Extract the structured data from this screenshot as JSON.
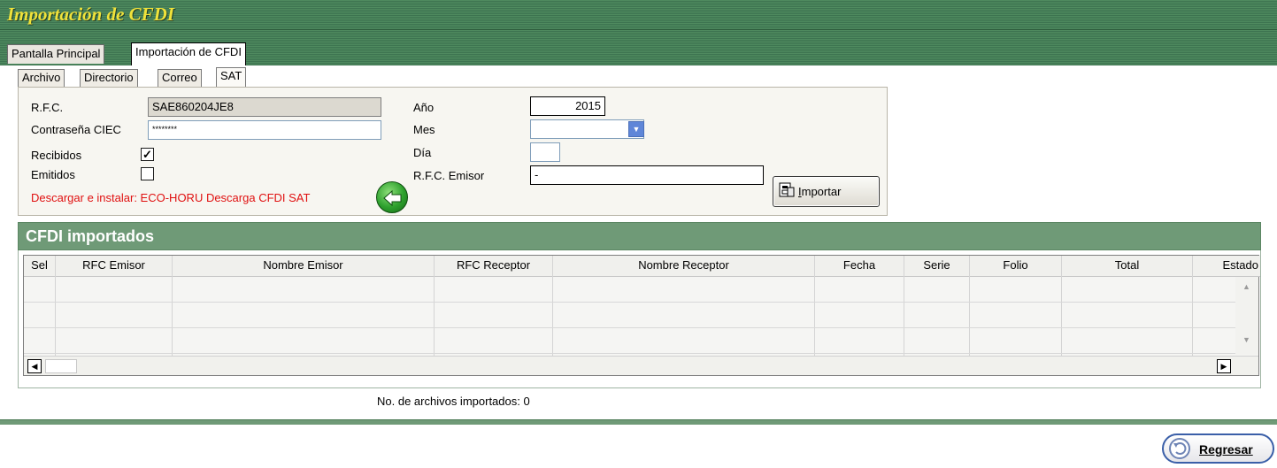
{
  "window": {
    "title": "Importación de CFDI"
  },
  "main_tabs": [
    {
      "label": "Pantalla Principal",
      "active": false
    },
    {
      "label": "Importación de CFDI",
      "active": true
    }
  ],
  "sub_tabs": [
    {
      "label": "Archivo",
      "active": false
    },
    {
      "label": "Directorio",
      "active": false
    },
    {
      "label": "Correo",
      "active": false
    },
    {
      "label": "SAT",
      "active": true
    }
  ],
  "sat_form": {
    "rfc_label": "R.F.C.",
    "rfc_value": "SAE860204JE8",
    "ciec_label": "Contraseña CIEC",
    "ciec_value": "********",
    "recibidos_label": "Recibidos",
    "recibidos_checked": true,
    "emitidos_label": "Emitidos",
    "emitidos_checked": false,
    "anio_label": "Año",
    "anio_value": "2015",
    "mes_label": "Mes",
    "mes_value": "",
    "dia_label": "Día",
    "dia_value": "",
    "rfc_emisor_label": "R.F.C. Emisor",
    "rfc_emisor_value": "-",
    "download_link": "Descargar e instalar: ECO-HORU Descarga CFDI SAT",
    "importar_button": "Importar"
  },
  "cfdi_section": {
    "title": "CFDI importados",
    "columns": [
      "Sel",
      "RFC Emisor",
      "Nombre Emisor",
      "RFC Receptor",
      "Nombre Receptor",
      "Fecha",
      "Serie",
      "Folio",
      "Total",
      "Estado"
    ],
    "rows": []
  },
  "status": {
    "text": "No. de archivos importados: 0"
  },
  "footer": {
    "regresar_button": "Regresar"
  },
  "colors": {
    "title_text": "#f0e23a",
    "header_green": "#6f9a77",
    "link_red": "#e01010",
    "button_border_blue": "#3a5fa8"
  }
}
